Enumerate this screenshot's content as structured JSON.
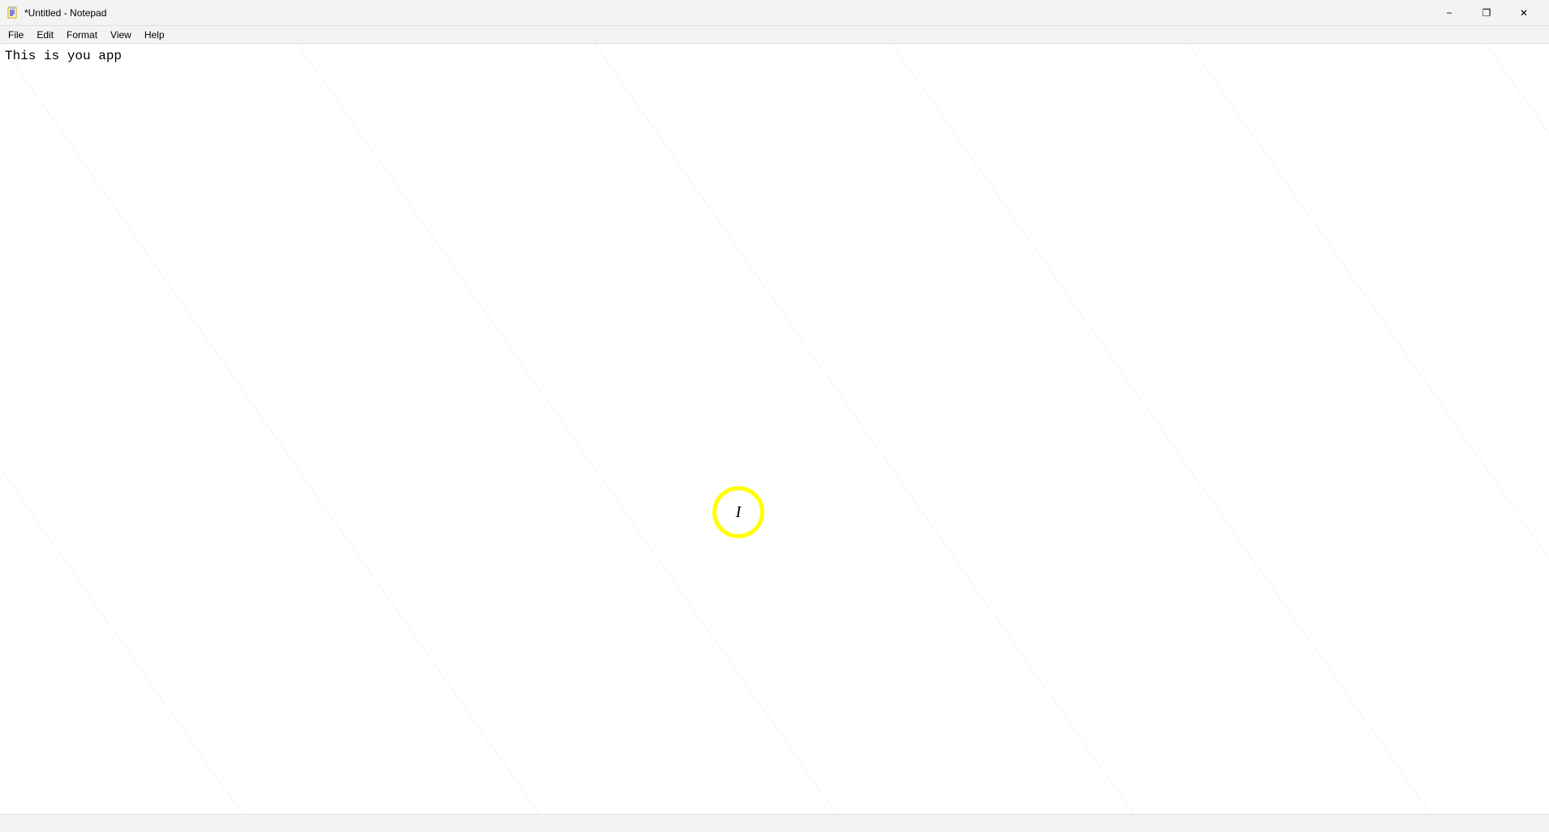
{
  "titleBar": {
    "title": "*Untitled - Notepad",
    "icon": "notepad-icon",
    "controls": {
      "minimize": "−",
      "restore": "❐",
      "close": "✕"
    }
  },
  "menuBar": {
    "items": [
      "File",
      "Edit",
      "Format",
      "View",
      "Help"
    ]
  },
  "editor": {
    "content": "This is you app"
  },
  "statusBar": {
    "text": ""
  },
  "cursor": {
    "symbol": "I"
  }
}
